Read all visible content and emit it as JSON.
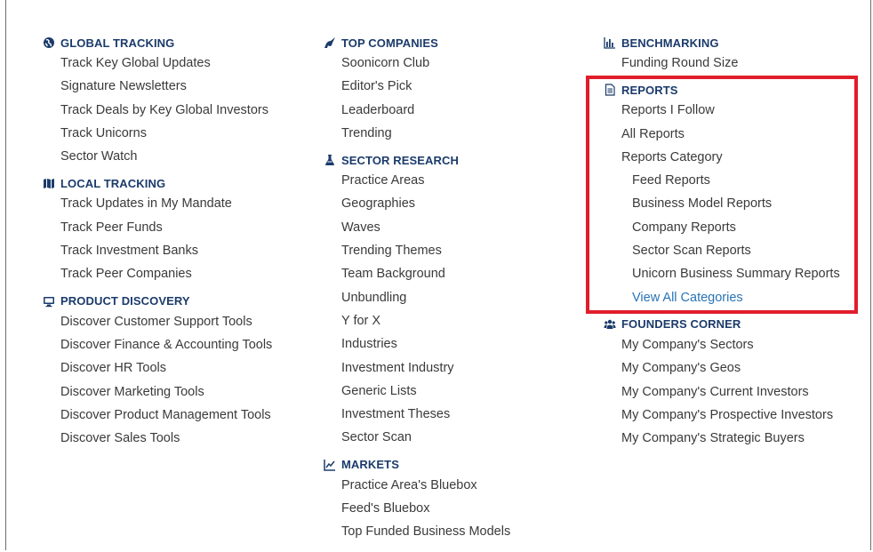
{
  "columns": [
    {
      "sections": [
        {
          "title": "GLOBAL TRACKING",
          "icon": "globe-icon",
          "items": [
            "Track Key Global Updates",
            "Signature Newsletters",
            "Track Deals by Key Global Investors",
            "Track Unicorns",
            "Sector Watch"
          ]
        },
        {
          "title": "LOCAL TRACKING",
          "icon": "map-icon",
          "items": [
            "Track Updates in My Mandate",
            "Track Peer Funds",
            "Track Investment Banks",
            "Track Peer Companies"
          ]
        },
        {
          "title": "PRODUCT DISCOVERY",
          "icon": "monitor-icon",
          "items": [
            "Discover Customer Support Tools",
            "Discover Finance & Accounting Tools",
            "Discover HR Tools",
            "Discover Marketing Tools",
            "Discover Product Management Tools",
            "Discover Sales Tools"
          ]
        }
      ]
    },
    {
      "sections": [
        {
          "title": "TOP COMPANIES",
          "icon": "unicorn-icon",
          "items": [
            "Soonicorn Club",
            "Editor's Pick",
            "Leaderboard",
            "Trending"
          ]
        },
        {
          "title": "SECTOR RESEARCH",
          "icon": "flask-icon",
          "items": [
            "Practice Areas",
            "Geographies",
            "Waves",
            "Trending Themes",
            "Team Background",
            "Unbundling",
            "Y for X",
            "Industries",
            "Investment Industry",
            "Generic Lists",
            "Investment Theses",
            "Sector Scan"
          ]
        },
        {
          "title": "MARKETS",
          "icon": "line-chart-icon",
          "items": [
            "Practice Area's Bluebox",
            "Feed's Bluebox",
            "Top Funded Business Models"
          ]
        }
      ]
    },
    {
      "sections": [
        {
          "title": "BENCHMARKING",
          "icon": "bar-chart-icon",
          "items": [
            "Funding Round Size"
          ]
        },
        {
          "title": "REPORTS",
          "icon": "document-icon",
          "items": [
            "Reports I Follow",
            "All Reports",
            "Reports Category"
          ],
          "sub_items": [
            "Feed Reports",
            "Business Model Reports",
            "Company Reports",
            "Sector Scan Reports",
            "Unicorn Business Summary Reports"
          ],
          "link": "View All Categories"
        },
        {
          "title": "FOUNDERS CORNER",
          "icon": "users-icon",
          "items": [
            "My Company's Sectors",
            "My Company's Geos",
            "My Company's Current Investors",
            "My Company's Prospective Investors",
            "My Company's Strategic Buyers"
          ]
        }
      ]
    }
  ],
  "colors": {
    "heading": "#1b3b6b",
    "text": "#3a3a3a",
    "link": "#2a73b6",
    "highlight": "#e01e2a"
  }
}
